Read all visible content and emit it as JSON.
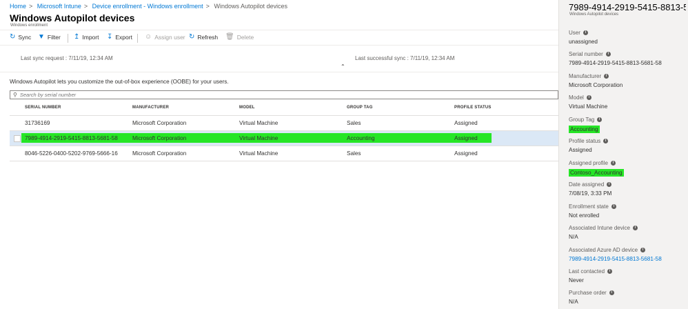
{
  "breadcrumb": [
    {
      "label": "Home"
    },
    {
      "label": "Microsoft Intune"
    },
    {
      "label": "Device enrollment - Windows enrollment"
    },
    {
      "label": "Windows Autopilot devices"
    }
  ],
  "page": {
    "title": "Windows Autopilot devices",
    "subtitle": "Windows enrollment"
  },
  "toolbar": {
    "sync": "Sync",
    "filter": "Filter",
    "import": "Import",
    "export": "Export",
    "assign_user": "Assign user",
    "refresh": "Refresh",
    "delete": "Delete"
  },
  "sync": {
    "last_request_label": "Last sync request",
    "last_request_value": "7/11/19, 12:34 AM",
    "last_success_label": "Last successful sync",
    "last_success_value": "7/11/19, 12:34 AM"
  },
  "info_text": "Windows Autopilot lets you customize the out-of-box experience (OOBE) for your users.",
  "search": {
    "placeholder": "Search by serial number"
  },
  "table": {
    "headers": [
      "SERIAL NUMBER",
      "MANUFACTURER",
      "MODEL",
      "GROUP TAG",
      "PROFILE STATUS"
    ],
    "rows": [
      {
        "serial": "31736169",
        "manufacturer": "Microsoft Corporation",
        "model": "Virtual Machine",
        "group_tag": "Sales",
        "status": "Assigned"
      },
      {
        "serial": "7989-4914-2919-5415-8813-5681-58",
        "manufacturer": "Microsoft Corporation",
        "model": "Virtual Machine",
        "group_tag": "Accounting",
        "status": "Assigned"
      },
      {
        "serial": "8046-5226-0400-5202-9769-5666-16",
        "manufacturer": "Microsoft Corporation",
        "model": "Virtual Machine",
        "group_tag": "Sales",
        "status": "Assigned"
      }
    ]
  },
  "details": {
    "title": "7989-4914-2919-5415-8813-5...",
    "subtitle": "Windows Autopilot devices",
    "fields": [
      {
        "label": "User",
        "value": "unassigned"
      },
      {
        "label": "Serial number",
        "value": "7989-4914-2919-5415-8813-5681-58"
      },
      {
        "label": "Manufacturer",
        "value": "Microsoft Corporation"
      },
      {
        "label": "Model",
        "value": "Virtual Machine"
      },
      {
        "label": "Group Tag",
        "value": "Accounting"
      },
      {
        "label": "Profile status",
        "value": "Assigned"
      },
      {
        "label": "Assigned profile",
        "value": "Contoso_Accounting"
      },
      {
        "label": "Date assigned",
        "value": "7/08/19, 3:33 PM"
      },
      {
        "label": "Enrollment state",
        "value": "Not enrolled"
      },
      {
        "label": "Associated Intune device",
        "value": "N/A"
      },
      {
        "label": "Associated Azure AD device",
        "value": "7989-4914-2919-5415-8813-5681-58"
      },
      {
        "label": "Last contacted",
        "value": "Never"
      },
      {
        "label": "Purchase order",
        "value": "N/A"
      }
    ]
  },
  "colors": {
    "accent": "#0078d4",
    "highlight": "#26e626",
    "selected_row": "#dbe8f6"
  },
  "icons": {
    "sync": "sync-icon",
    "filter": "filter-icon",
    "import": "import-icon",
    "export": "export-icon",
    "assign_user": "assign-user-icon",
    "refresh": "refresh-icon",
    "delete": "delete-icon",
    "search": "search-icon",
    "info": "info-icon",
    "collapse": "collapse-chevron-icon"
  }
}
